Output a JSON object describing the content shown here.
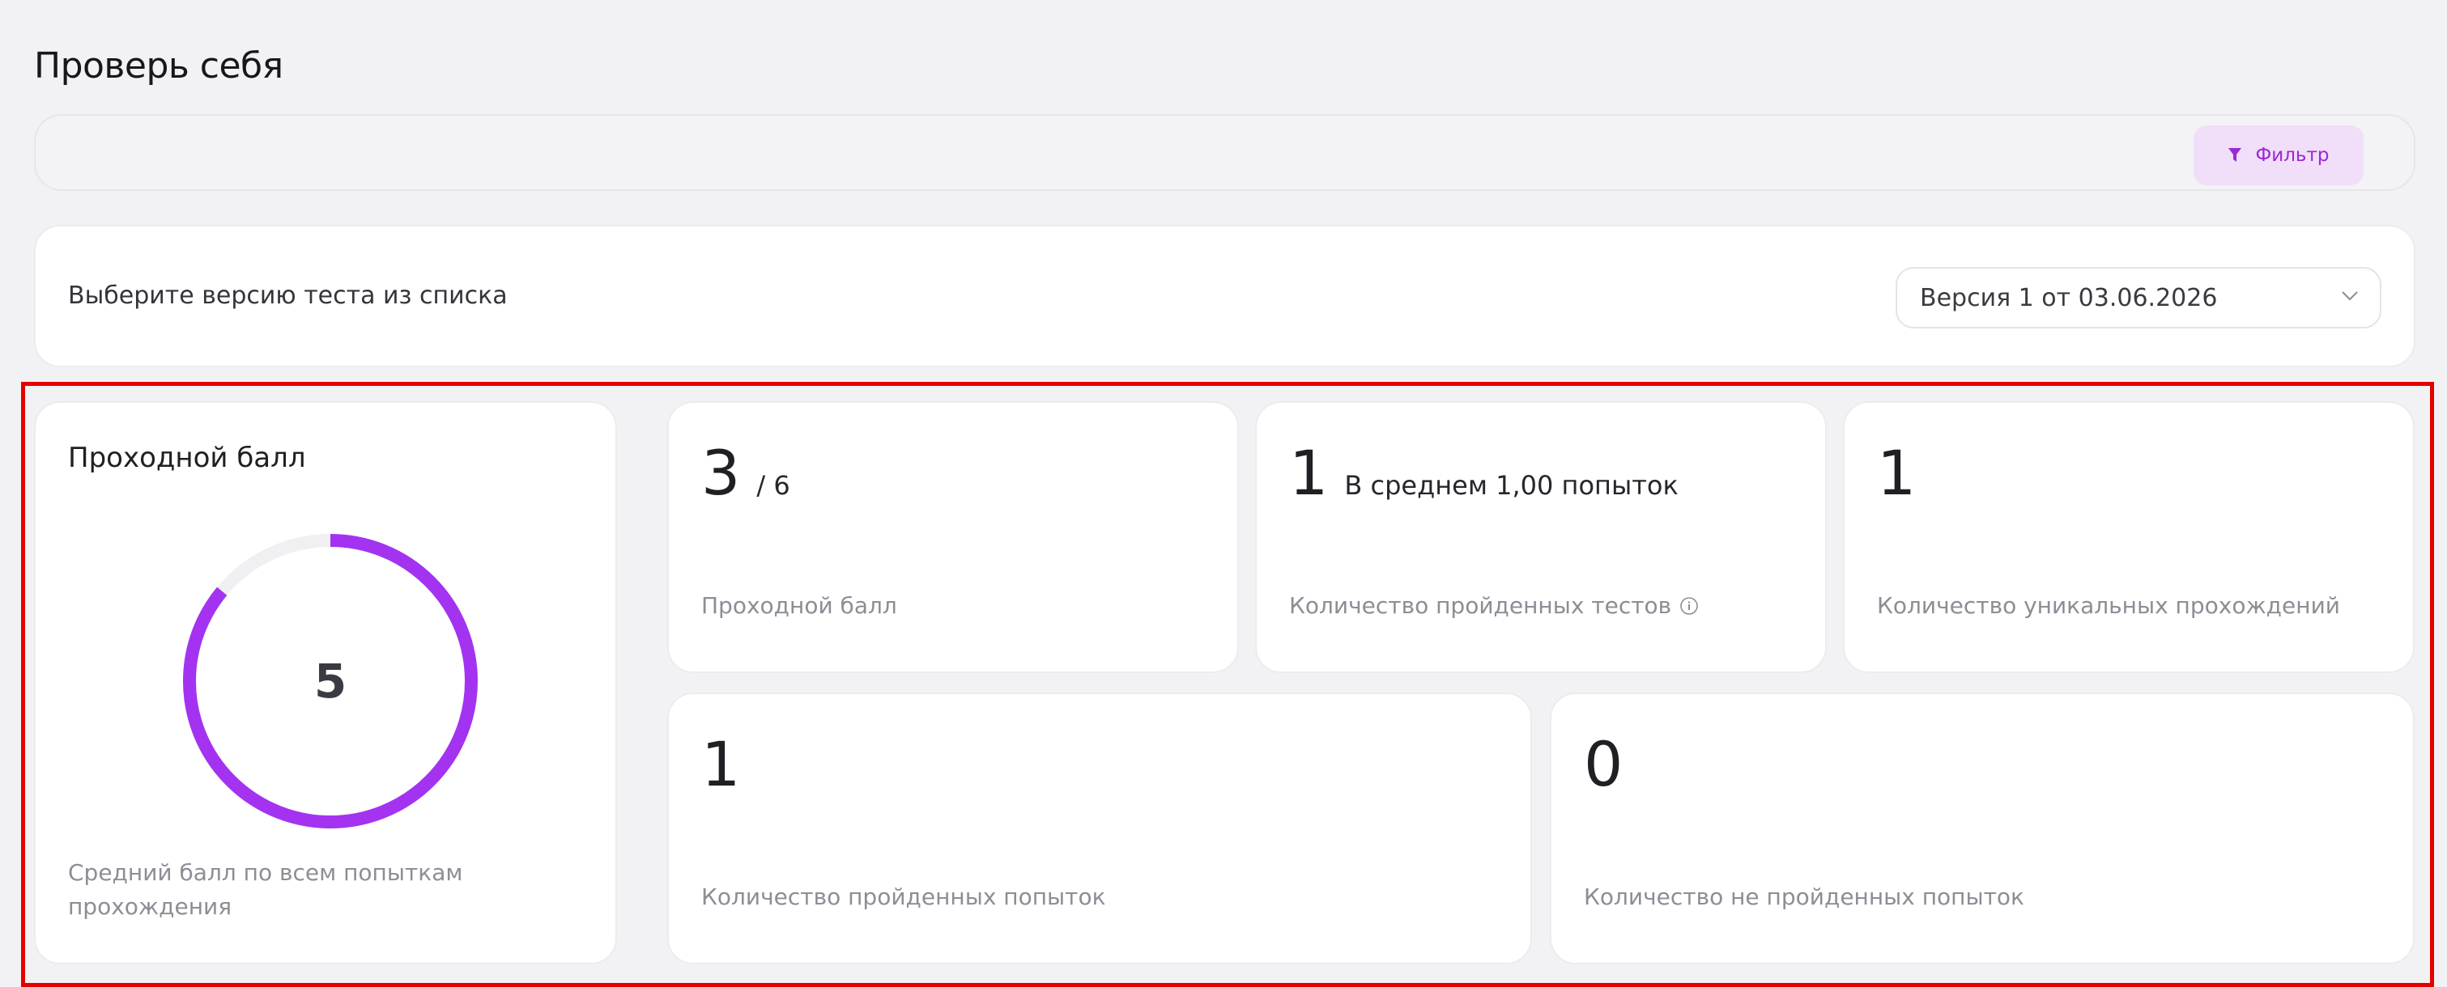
{
  "page": {
    "title": "Проверь себя"
  },
  "filter": {
    "button_label": "Фильтр",
    "icon": "funnel-icon"
  },
  "version": {
    "label": "Выберите версию теста из списка",
    "selected": "Версия 1 от 03.06.2026"
  },
  "donut_card": {
    "title": "Проходной балл",
    "value": "5",
    "fill_fraction": 0.86,
    "caption": "Средний балл по всем попыткам прохождения",
    "colors": {
      "fill": "#a333f0",
      "track": "#f0f0f2"
    }
  },
  "stats": {
    "pass_score": {
      "value": "3",
      "suffix": "/ 6",
      "label": "Проходной балл"
    },
    "tests_passed": {
      "value": "1",
      "aside": "В среднем 1,00 попыток",
      "label": "Количество пройденных тестов"
    },
    "unique_passes": {
      "value": "1",
      "label": "Количество уникальных прохождений"
    },
    "passed_attempts": {
      "value": "1",
      "label": "Количество пройденных попыток"
    },
    "failed_attempts": {
      "value": "0",
      "label": "Количество не пройденных попыток"
    }
  },
  "colors": {
    "accent": "#9b28d4",
    "accent_bg": "#f1def9",
    "highlight": "#e50000"
  }
}
